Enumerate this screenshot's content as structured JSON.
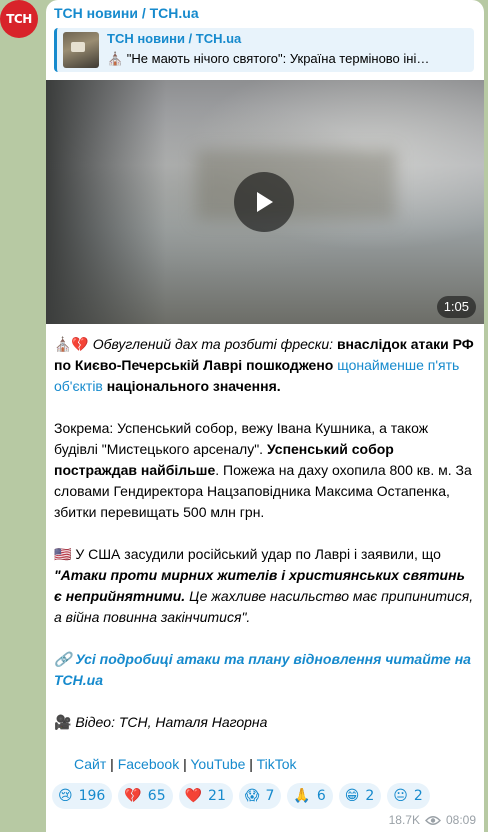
{
  "avatar": {
    "text": "ТСН"
  },
  "channel": {
    "name": "ТСН новини / ТСН.ua"
  },
  "reply": {
    "title": "ТСН новини / ТСН.ua",
    "text": "⛪ \"Не мають нічого святого\": Україна терміново іні…"
  },
  "video": {
    "duration": "1:05"
  },
  "message": {
    "p1": {
      "emoji": "⛪💔",
      "italic": "Обвуглений дах та розбиті фрески:",
      "bold_a": "внаслідок атаки РФ по Києво-Печерській Лаврі пошкоджено",
      "link": "щонайменше п'ять об'єктів",
      "bold_b": "національного значення."
    },
    "p2": {
      "plain_a": "Зокрема: Успенський собор, вежу Івана Кушника, а також будівлі \"Мистецького арсеналу\". ",
      "bold": "Успенський собор постраждав найбільше",
      "plain_b": ". Пожежа на даху охопила 800 кв. м. За словами Гендиректора Нацзаповідника Максима Остапенка, збитки перевищать 500 млн грн."
    },
    "p3": {
      "plain": "🇺🇸 У США засудили російський удар по Лаврі і заявили, що ",
      "bold_italic": "\"Атаки проти мирних жителів і християнських святинь є неприйнятними.",
      "italic": " Це жахливе насильство має припинитися, а війна повинна закінчитися\"."
    },
    "p4": {
      "link": "🔗 Усі подробиці атаки та плану відновлення читайте на ТСН.ua"
    },
    "p5": {
      "emoji": "🎥",
      "italic": " Відео: ТСН, Наталя Нагорна"
    },
    "links": [
      "Сайт",
      "Facebook",
      "YouTube",
      "TikTok"
    ],
    "separator": " | "
  },
  "reactions": [
    {
      "emoji": "😢",
      "count": "196"
    },
    {
      "emoji": "💔",
      "count": "65"
    },
    {
      "emoji": "❤️",
      "count": "21"
    },
    {
      "emoji": "😱",
      "count": "7"
    },
    {
      "emoji": "🙏",
      "count": "6"
    },
    {
      "emoji": "😁",
      "count": "2"
    },
    {
      "emoji": "😐",
      "count": "2"
    }
  ],
  "meta": {
    "views": "18.7K",
    "time": "08:09"
  },
  "icons": {
    "play": "play-icon",
    "views": "eye-icon"
  },
  "colors": {
    "accent": "#168acd",
    "avatar_bg": "#d8232a",
    "background": "#b7c9a3"
  }
}
